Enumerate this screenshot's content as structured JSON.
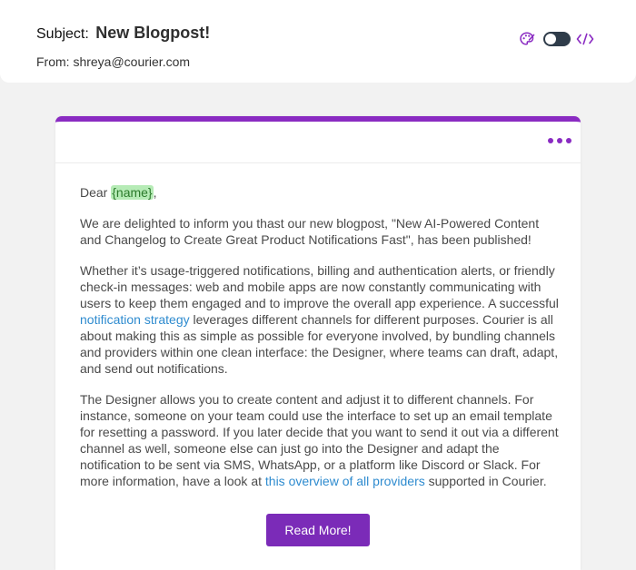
{
  "header": {
    "subject_label": "Subject:",
    "subject_value": "New Blogpost!",
    "from_text": "From: shreya@courier.com",
    "tools": {
      "theme_icon": "palette-icon",
      "toggle_icon": "toggle-switch",
      "code_icon": "code-icon"
    }
  },
  "card": {
    "accent_color": "#8a2bc2",
    "menu_icon": "more-horizontal-icon",
    "greeting_prefix": "Dear ",
    "name_variable": "{name}",
    "greeting_suffix": ",",
    "paragraph_1": "We are delighted to inform you thast our new blogpost, \"New AI-Powered Content and Changelog to Create Great Product Notifications Fast\", has been published!",
    "paragraph_2_part_1": "Whether it’s usage-triggered notifications, billing and authentication alerts, or friendly check-in messages: web and mobile apps are now constantly communicating with users to keep them engaged and to improve the overall app experience. A successful ",
    "paragraph_2_link": "notification strategy",
    "paragraph_2_part_2": " leverages different channels for different purposes. Courier is all about making this as simple as possible for everyone involved, by bundling channels and providers within one clean interface: the Designer, where teams can draft, adapt, and send out notifications.",
    "paragraph_3_part_1": "The Designer allows you to create content and adjust it to different channels. For instance, someone on your team could use the interface to set up an email template for resetting a password. If you later decide that you want to send it out via a different channel as well, someone else can just go into the Designer and adapt the notification to be sent via SMS, WhatsApp, or a platform like Discord or Slack. For more information, have a look at ",
    "paragraph_3_link": "this overview of all providers",
    "paragraph_3_part_2": " supported in Courier.",
    "cta_label": "Read More!",
    "link_color": "#2e8bcf",
    "variable_color": "#b6ebb6"
  }
}
